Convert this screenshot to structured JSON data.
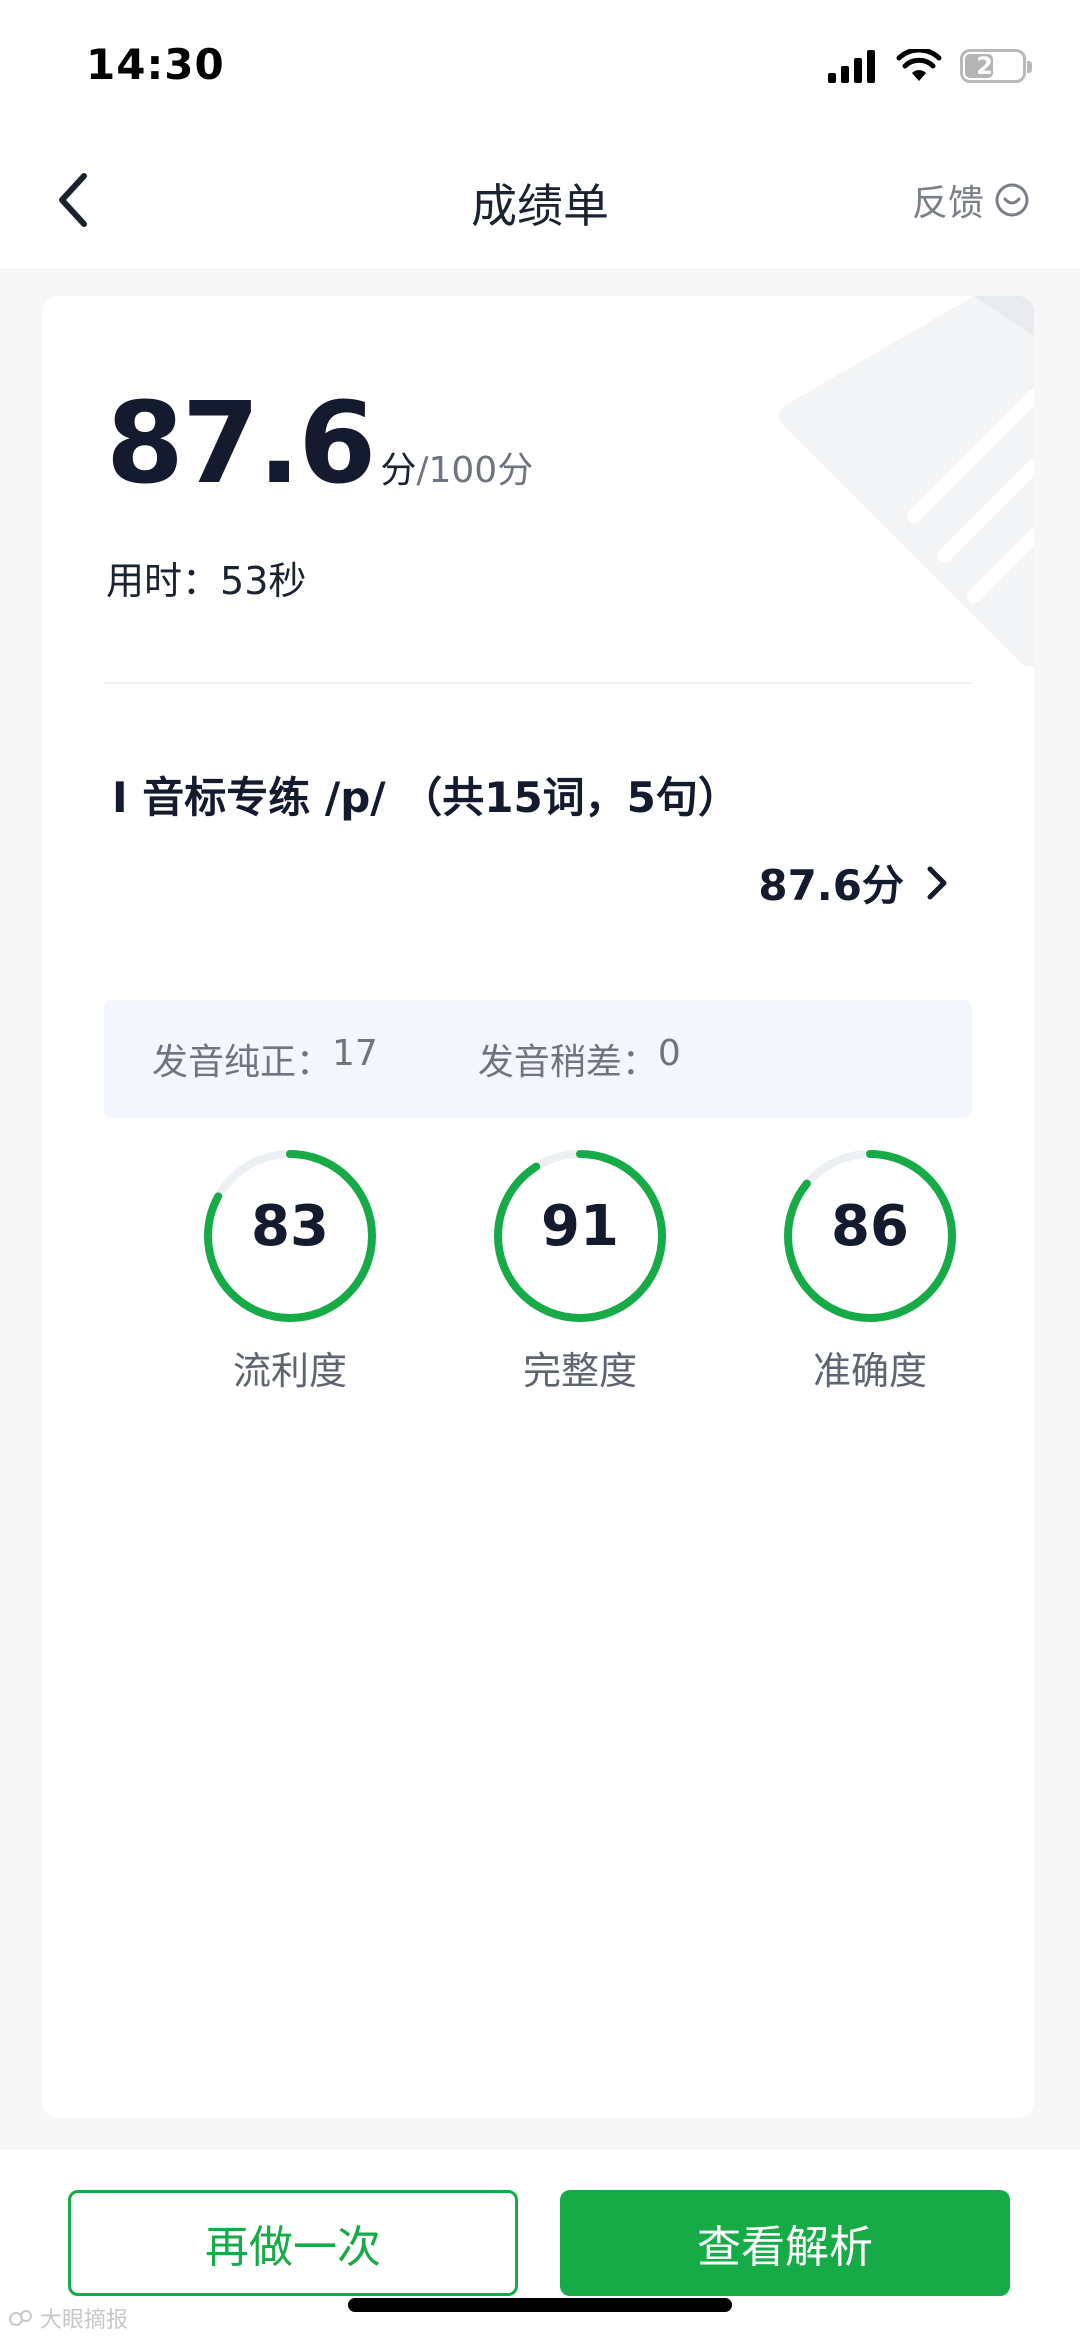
{
  "status_bar": {
    "time": "14:30",
    "battery": "21"
  },
  "nav": {
    "title": "成绩单",
    "feedback_label": "反馈"
  },
  "score": {
    "value": "87.6",
    "unit": "分",
    "total": "/100分"
  },
  "time_used": {
    "label": "用时：",
    "value": "53秒"
  },
  "exercise": {
    "title": "I 音标专练 /p/ （共15词，5句）",
    "score": "87.6分"
  },
  "pronunciation": {
    "standard_label": "发音纯正：",
    "standard_value": "17",
    "poor_label": "发音稍差：",
    "poor_value": "0"
  },
  "metrics": [
    {
      "value": "83",
      "label": "流利度",
      "percent": 83
    },
    {
      "value": "91",
      "label": "完整度",
      "percent": 91
    },
    {
      "value": "86",
      "label": "准确度",
      "percent": 86
    }
  ],
  "actions": {
    "redo_label": "再做一次",
    "analysis_label": "查看解析"
  },
  "watermark": "大眼摘报",
  "colors": {
    "accent": "#16ab46",
    "track": "#eceff3",
    "text": "#141b2e"
  }
}
